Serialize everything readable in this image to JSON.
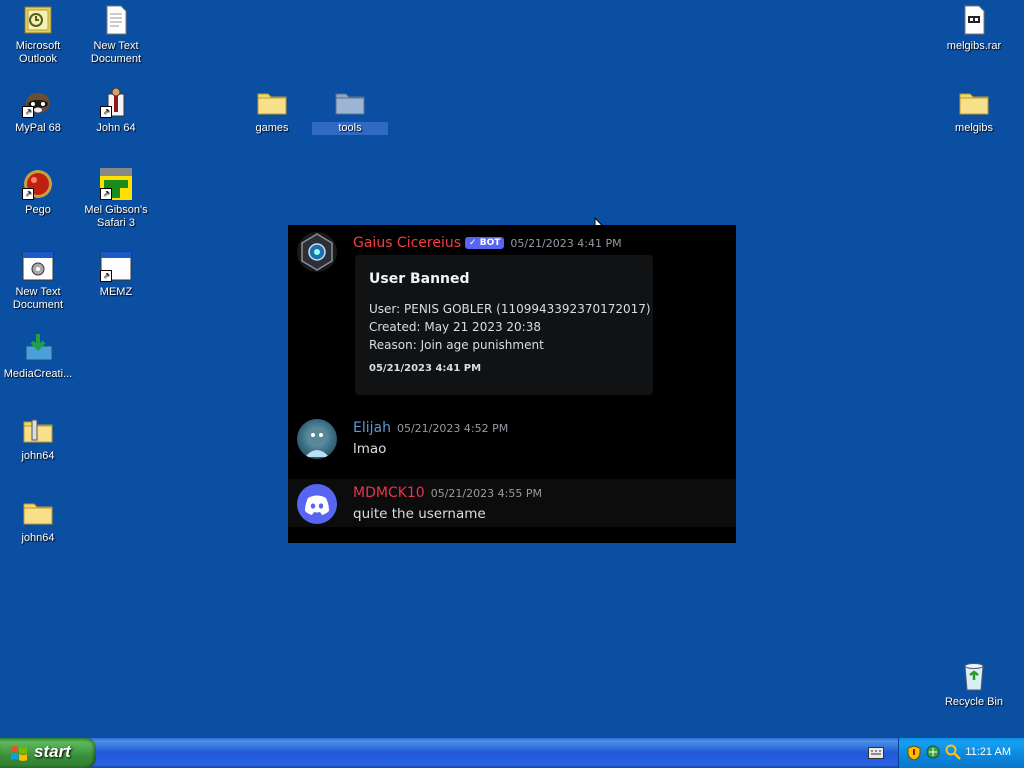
{
  "desktop": {
    "icons": {
      "outlook": "Microsoft Outlook",
      "newtext1": "New Text Document",
      "melgibs_rar": "melgibs.rar",
      "mypal": "MyPal 68",
      "john64_app": "John 64",
      "games": "games",
      "tools": "tools",
      "melgibs_folder": "melgibs",
      "pego": "Pego",
      "mel_safari": "Mel Gibson's Safari 3",
      "newtext2": "New Text Document",
      "memz": "MEMZ",
      "mediacreation": "MediaCreati...",
      "john64_zip": "john64",
      "john64_folder": "john64",
      "recycle": "Recycle Bin"
    }
  },
  "discord": {
    "messages": [
      {
        "author": "Gaius Cicereius",
        "author_color": "#f23f43",
        "bot_tag": "✓ BOT",
        "timestamp": "05/21/2023 4:41 PM",
        "embed": {
          "title": "User Banned",
          "user": "User: PENIS GOBLER (1109943392370172017)",
          "created": "Created: May 21 2023 20:38",
          "reason": "Reason: Join age punishment",
          "footer": "05/21/2023 4:41 PM"
        }
      },
      {
        "author": "Elijah",
        "author_color": "#5b9bd5",
        "timestamp": "05/21/2023 4:52 PM",
        "content": "lmao"
      },
      {
        "author": "MDMCK10",
        "author_color": "#e8334f",
        "timestamp": "05/21/2023 4:55 PM",
        "content": "quite the username"
      }
    ]
  },
  "taskbar": {
    "start_label": "start",
    "clock": "11:21 AM"
  }
}
